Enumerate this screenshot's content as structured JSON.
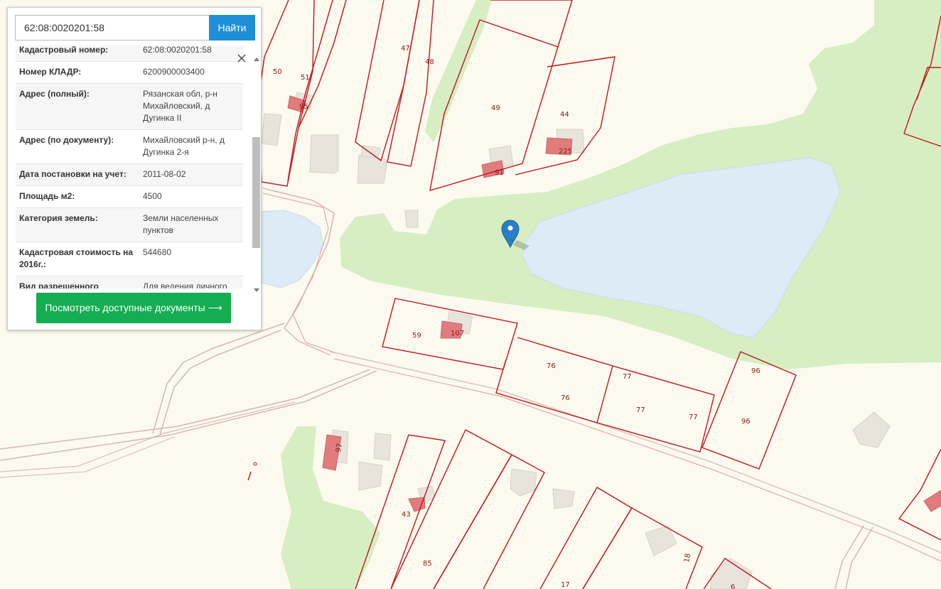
{
  "search": {
    "value": "62:08:0020201:58",
    "button_label": "Найти"
  },
  "info_rows": [
    {
      "key": "Кадастровый номер:",
      "value": "62:08:0020201:58"
    },
    {
      "key": "Номер КЛАДР:",
      "value": "6200900003400"
    },
    {
      "key": "Адрес (полный):",
      "value": "Рязанская обл, р-н Михайловский, д Дугинка II"
    },
    {
      "key": "Адрес (по документу):",
      "value": "Михайловский р-н, д Дугинка 2-я"
    },
    {
      "key": "Дата постановки на учет:",
      "value": "2011-08-02"
    },
    {
      "key": "Площадь м2:",
      "value": "4500"
    },
    {
      "key": "Категория земель:",
      "value": "Земли населенных пунктов"
    },
    {
      "key": "Кадастровая стоимость на 2016г.:",
      "value": "544680"
    },
    {
      "key": "Вид разрешенного использования (по",
      "value": "Для ведения личного подсобного хозяйства"
    }
  ],
  "docs_button_label": "Посмотреть доступные документы ⟶",
  "parcel_labels": [
    "50",
    "51",
    "95",
    "47",
    "48",
    "49",
    "44",
    "225",
    "91",
    "59",
    "107",
    "76",
    "76",
    "77",
    "77",
    "77",
    "96",
    "96",
    "97",
    "43",
    "85",
    "17",
    "18",
    "6"
  ],
  "colors": {
    "parcel_border": "#c2141e",
    "water": "#dcebf5",
    "vegetation": "#d6eec2",
    "building": "#e8e4dc",
    "building_red": "#e07c7c",
    "marker": "#2a7fc4",
    "search_button": "#1e8fd6",
    "docs_button": "#14ad52"
  }
}
